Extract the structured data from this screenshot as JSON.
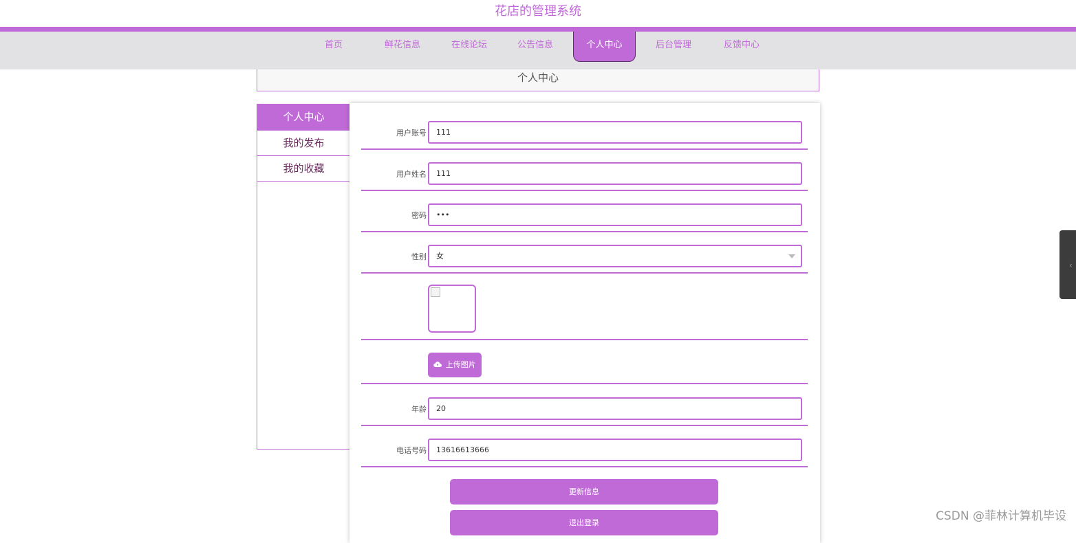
{
  "site": {
    "title": "花店的管理系统"
  },
  "nav": {
    "items": [
      {
        "label": "首页"
      },
      {
        "label": "鲜花信息"
      },
      {
        "label": "在线论坛"
      },
      {
        "label": "公告信息"
      },
      {
        "label": "个人中心"
      },
      {
        "label": "后台管理"
      },
      {
        "label": "反馈中心"
      }
    ],
    "active": "个人中心"
  },
  "page": {
    "header": "个人中心"
  },
  "sidebar": {
    "items": [
      {
        "label": "个人中心"
      },
      {
        "label": "我的发布"
      },
      {
        "label": "我的收藏"
      }
    ]
  },
  "form": {
    "account": {
      "label": "用户账号",
      "value": "111"
    },
    "name": {
      "label": "用户姓名",
      "value": "111"
    },
    "password": {
      "label": "密码",
      "value": "•••"
    },
    "gender": {
      "label": "性别",
      "value": "女"
    },
    "upload_label": "上传图片",
    "age": {
      "label": "年龄",
      "value": "20"
    },
    "phone": {
      "label": "电话号码",
      "value": "13616613666"
    },
    "update_label": "更新信息",
    "logout_label": "退出登录"
  },
  "watermark": "CSDN @菲林计算机毕设",
  "colors": {
    "accent": "#c06ad8",
    "nav_bg": "#e2e1e3"
  },
  "icons": {
    "upload": "cloud-upload-icon",
    "caret": "chevron-down-icon"
  }
}
